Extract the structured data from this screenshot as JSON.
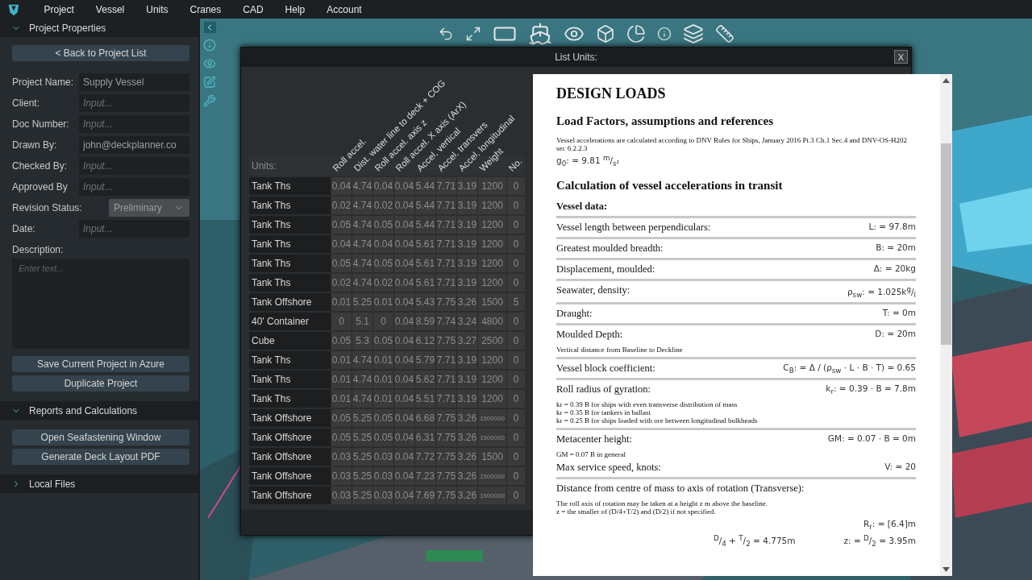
{
  "menu": [
    "Project",
    "Vessel",
    "Units",
    "Cranes",
    "CAD",
    "Help",
    "Account"
  ],
  "sidebar": {
    "project_properties": {
      "title": "Project Properties",
      "expanded": true,
      "back_button": "<  Back to Project List",
      "fields": [
        {
          "kind": "input",
          "label": "Project Name:",
          "value": "Supply Vessel"
        },
        {
          "kind": "input",
          "label": "Client:",
          "placeholder": "Input..."
        },
        {
          "kind": "input",
          "label": "Doc Number:",
          "placeholder": "Input..."
        },
        {
          "kind": "input",
          "label": "Drawn By:",
          "value": "john@deckplanner.co"
        },
        {
          "kind": "input",
          "label": "Checked By:",
          "placeholder": "Input..."
        },
        {
          "kind": "input",
          "label": "Approved By",
          "placeholder": "Input..."
        },
        {
          "kind": "select",
          "label": "Revision Status:",
          "value": "Preliminary",
          "disabled": true
        },
        {
          "kind": "input",
          "label": "Date:",
          "placeholder": "Input..."
        }
      ],
      "description": {
        "label": "Description:",
        "placeholder": "Enter text..."
      },
      "buttons": [
        "Save Current Project in Azure",
        "Duplicate Project"
      ]
    },
    "reports": {
      "title": "Reports and Calculations",
      "expanded": true,
      "buttons": [
        "Open Seafastening Window",
        "Generate Deck Layout PDF"
      ]
    },
    "local_files": {
      "title": "Local Files",
      "expanded": false
    }
  },
  "dialog": {
    "title": "List Units:",
    "close": "X",
    "units_label": "Units:",
    "columns": [
      "Roll accel.",
      "Dist. water line to deck + COG",
      "Roll accel. axis z",
      "Roll accel. X axis (ArX)",
      "Accel. vertical",
      "Accel. transvers",
      "Accel. longitudinal",
      "Weight",
      "No."
    ],
    "rows": [
      {
        "name": "Tank Ths",
        "cells": [
          "0.04",
          "4.74",
          "0.04",
          "0.04",
          "5.44",
          "7.71",
          "3.19",
          "1200",
          "0"
        ]
      },
      {
        "name": "Tank Ths",
        "cells": [
          "0.02",
          "4.74",
          "0.02",
          "0.04",
          "5.44",
          "7.71",
          "3.19",
          "1200",
          "0"
        ]
      },
      {
        "name": "Tank Ths",
        "cells": [
          "0.05",
          "4.74",
          "0.05",
          "0.04",
          "5.44",
          "7.71",
          "3.19",
          "1200",
          "0"
        ]
      },
      {
        "name": "Tank Ths",
        "cells": [
          "0.04",
          "4.74",
          "0.04",
          "0.04",
          "5.61",
          "7.71",
          "3.19",
          "1200",
          "0"
        ]
      },
      {
        "name": "Tank Ths",
        "cells": [
          "0.05",
          "4.74",
          "0.05",
          "0.04",
          "5.61",
          "7.71",
          "3.19",
          "1200",
          "0"
        ]
      },
      {
        "name": "Tank Ths",
        "cells": [
          "0.02",
          "4.74",
          "0.02",
          "0.04",
          "5.61",
          "7.71",
          "3.19",
          "1200",
          "0"
        ]
      },
      {
        "name": "Tank Offshore",
        "cells": [
          "0.01",
          "5.25",
          "0.01",
          "0.04",
          "5.43",
          "7.75",
          "3.26",
          "1500",
          "5"
        ]
      },
      {
        "name": "40' Container",
        "cells": [
          "0",
          "5.1",
          "0",
          "0.04",
          "8.59",
          "7.74",
          "3.24",
          "4800",
          "0"
        ]
      },
      {
        "name": "Cube",
        "cells": [
          "0.05",
          "5.3",
          "0.05",
          "0.04",
          "6.12",
          "7.75",
          "3.27",
          "2500",
          "0"
        ]
      },
      {
        "name": "Tank Ths",
        "cells": [
          "0.01",
          "4.74",
          "0.01",
          "0.04",
          "5.79",
          "7.71",
          "3.19",
          "1200",
          "0"
        ]
      },
      {
        "name": "Tank Ths",
        "cells": [
          "0.01",
          "4.74",
          "0.01",
          "0.04",
          "5.62",
          "7.71",
          "3.19",
          "1200",
          "0"
        ]
      },
      {
        "name": "Tank Ths",
        "cells": [
          "0.01",
          "4.74",
          "0.01",
          "0.04",
          "5.51",
          "7.71",
          "3.19",
          "1200",
          "0"
        ]
      },
      {
        "name": "Tank Offshore",
        "cells": [
          "0.05",
          "5.25",
          "0.05",
          "0.04",
          "6.68",
          "7.75",
          "3.26",
          "1500000",
          "0"
        ]
      },
      {
        "name": "Tank Offshore",
        "cells": [
          "0.05",
          "5.25",
          "0.05",
          "0.04",
          "6.31",
          "7.75",
          "3.26",
          "1500000",
          "0"
        ]
      },
      {
        "name": "Tank Offshore",
        "cells": [
          "0.03",
          "5.25",
          "0.03",
          "0.04",
          "7.72",
          "7.75",
          "3.26",
          "1500",
          "0"
        ]
      },
      {
        "name": "Tank Offshore",
        "cells": [
          "0.03",
          "5.25",
          "0.03",
          "0.04",
          "7.23",
          "7.75",
          "3.26",
          "1500000",
          "0"
        ]
      },
      {
        "name": "Tank Offshore",
        "cells": [
          "0.03",
          "5.25",
          "0.03",
          "0.04",
          "7.69",
          "7.75",
          "3.26",
          "1500000",
          "0"
        ]
      }
    ]
  },
  "document": {
    "blocks": [
      {
        "kind": "h1",
        "text": "DESIGN LOADS"
      },
      {
        "kind": "h2",
        "text": "Load Factors, assumptions and references"
      },
      {
        "kind": "note",
        "text": "Vessel accelerations are calculated according to DNV Rules for Ships, January 2016 Pt.3 Ch.1 Sec.4 and DNV-OS-H202 sec 6.2.2.3"
      },
      {
        "kind": "formula",
        "text": "g$_{0}$: = 9.81 $^{m}$/$_{s²}$"
      },
      {
        "kind": "h2",
        "text": "Calculation of vessel accelerations in transit"
      },
      {
        "kind": "h3",
        "text": "Vessel data:"
      },
      {
        "kind": "item",
        "divider": true,
        "label": "Vessel length between perpendiculars:",
        "formula": "L: = 97.8m"
      },
      {
        "kind": "item",
        "divider": true,
        "label": "Greatest moulded breadth:",
        "formula": "B: = 20m"
      },
      {
        "kind": "item",
        "divider": true,
        "label": "Displacement, moulded:",
        "formula": "Δ: = 20kg"
      },
      {
        "kind": "item",
        "divider": true,
        "label": "Seawater, density:",
        "formula": "ρ$_{sw}$: = 1.025k$^{g}$/$_{l}$"
      },
      {
        "kind": "item",
        "divider": true,
        "label": "Draught:",
        "formula": "T: = 0m"
      },
      {
        "kind": "item",
        "divider": true,
        "label": "Moulded Depth:",
        "formula": "D: = 20m",
        "notes": [
          "Vertical distance from Baseline to Deckline"
        ]
      },
      {
        "kind": "item",
        "divider": true,
        "label": "Vessel block coefficient:",
        "formula": "C$_{B}$: = Δ / (ρ$_{sw}$ · L · B · T) = 0.65"
      },
      {
        "kind": "item",
        "divider": true,
        "label": "Roll radius of gyration:",
        "formula": "k$_{r}$: = 0.39 · B = 7.8m",
        "notes": [
          "kr = 0.39 B for ships with even transverse distribution of mass",
          "kr = 0.35 B for tankers in ballast",
          "kr = 0.25 B for ships loaded with ore between longitudinal bulkheads"
        ]
      },
      {
        "kind": "item",
        "divider": true,
        "label": "Metacenter height:",
        "formula": "GM: = 0.07 · B = 0m",
        "notes": [
          "GM = 0.07 B in general"
        ]
      },
      {
        "kind": "subitem",
        "label": "Max service speed, knots:",
        "formula": "V: = 20"
      },
      {
        "kind": "item",
        "divider": true,
        "label": "Distance from centre of mass to axis of rotation (Transverse):",
        "notes": [
          "The roll axis of rotation may be taken at a height z m above the baseline.",
          "z = the smaller of (D/4+T/2) and (D/2) if not specified."
        ],
        "formula_rows": [
          [
            "R$_{r}$: = [6.4]m"
          ],
          [
            "$^{D}$/$_{4}$ + $^{T}$/$_{2}$ = 4.775m",
            "z: = $^{D}$/$_{2}$ = 3.95m"
          ]
        ]
      }
    ]
  }
}
